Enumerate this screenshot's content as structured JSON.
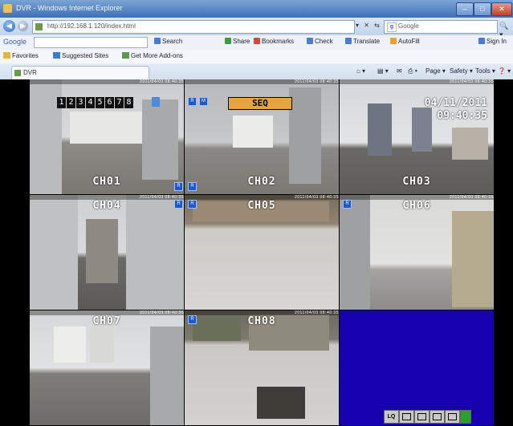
{
  "window": {
    "title": "DVR - Windows Internet Explorer",
    "min": "–",
    "max": "□",
    "close": "✕"
  },
  "address": {
    "url": "http://192.168.1.120/index.html",
    "tools": "▾ ✕ ⇆",
    "search_placeholder": "Google",
    "search_go": "🔍 ▾"
  },
  "google_toolbar": {
    "logo": "Google",
    "search": "Search",
    "share": "Share",
    "bookmarks": "Bookmarks",
    "check": "Check",
    "translate": "Translate",
    "autofill": "AutoFill",
    "signin": "Sign In"
  },
  "favorites": {
    "favorites": "Favorites",
    "suggested": "Suggested Sites",
    "gallery": "Get More Add-ons"
  },
  "tabs": [
    {
      "label": "DVR"
    }
  ],
  "commands": {
    "home": "⌂ ▾",
    "feeds": "▤ ▾",
    "mail": "✉",
    "print": "⎙ ▾",
    "page": "Page ▾",
    "safety": "Safety ▾",
    "tools": "Tools ▾",
    "help": "❓ ▾"
  },
  "dvr": {
    "channels": [
      {
        "label": "CH01",
        "osd": "2011/04/03 08:40:35"
      },
      {
        "label": "CH02",
        "osd": "2011/04/03 08:40:35"
      },
      {
        "label": "CH03",
        "osd": "2011/04/03 08:40:35"
      },
      {
        "label": "CH04",
        "osd": "2011/04/03 08:40:35"
      },
      {
        "label": "CH05",
        "osd": "2011/04/03 08:40:35"
      },
      {
        "label": "CH06",
        "osd": "2011/04/03 08:40:35"
      },
      {
        "label": "CH07",
        "osd": "2011/04/03 08:40:35"
      },
      {
        "label": "CH08",
        "osd": "2011/04/03 08:40:35"
      }
    ],
    "digits": [
      "1",
      "2",
      "3",
      "4",
      "5",
      "6",
      "7",
      "8"
    ],
    "sequence_box": "SEQ",
    "date": "04/11/2011",
    "time": "09:40:35",
    "controls": {
      "quality": "LQ"
    }
  }
}
